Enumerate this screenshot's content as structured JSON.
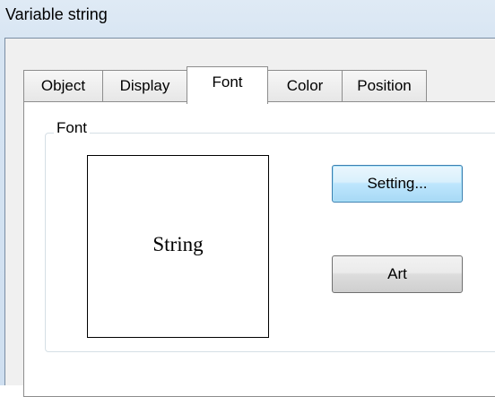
{
  "window": {
    "title": "Variable string"
  },
  "tabs": [
    {
      "label": "Object",
      "active": false
    },
    {
      "label": "Display",
      "active": false
    },
    {
      "label": "Font",
      "active": true
    },
    {
      "label": "Color",
      "active": false
    },
    {
      "label": "Position",
      "active": false
    }
  ],
  "font_group": {
    "label": "Font",
    "preview_text": "String",
    "setting_button": "Setting...",
    "art_button": "Art"
  }
}
